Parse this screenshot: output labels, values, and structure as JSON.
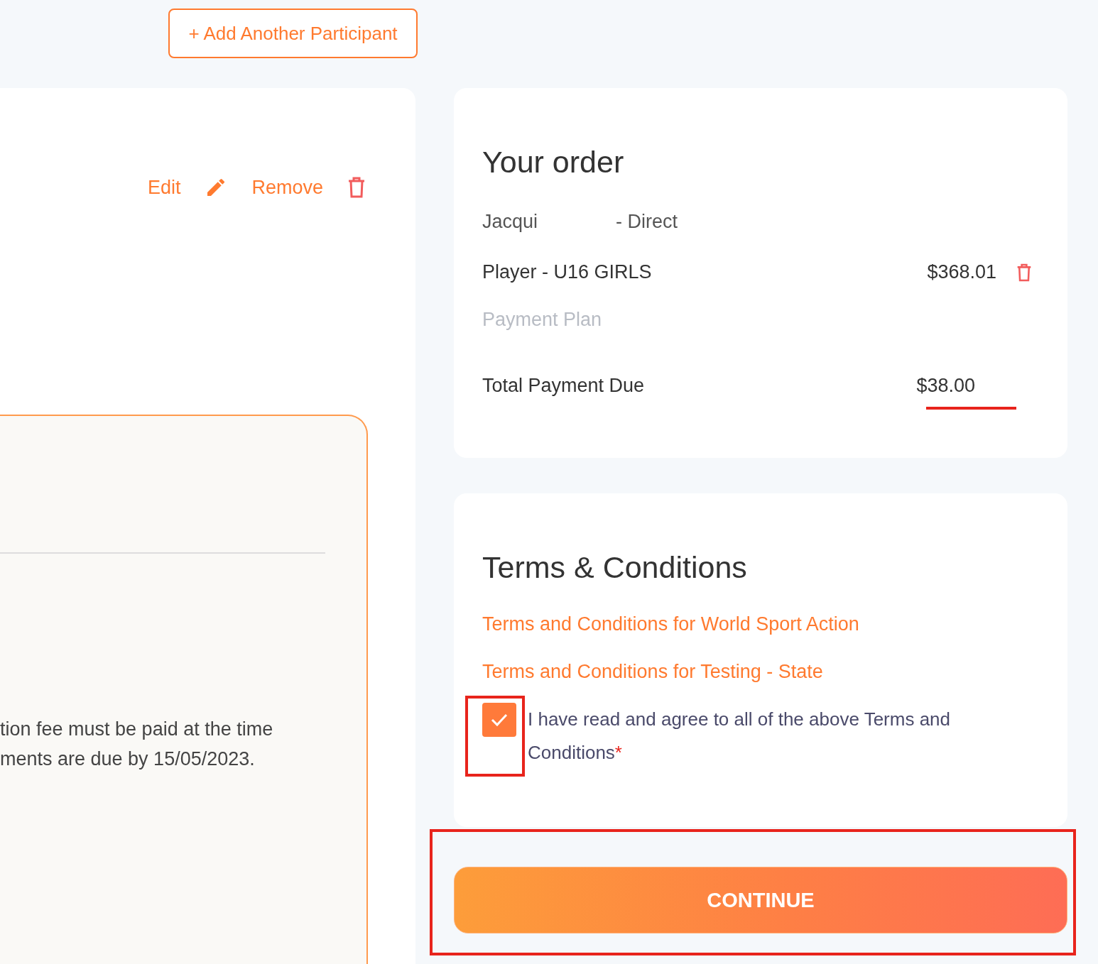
{
  "add_participant_button": "+ Add Another Participant",
  "participant_card": {
    "actions": [
      {
        "kind": "edit",
        "label": "Edit"
      },
      {
        "kind": "remove",
        "label": "Remove"
      }
    ],
    "info_lines": [
      "tion fee must be paid at the time",
      "ments are due by 15/05/2023."
    ]
  },
  "order": {
    "title": "Your order",
    "participant_name": "Jacqui",
    "participant_type": "- Direct",
    "item_name": "Player - U16 GIRLS",
    "item_price": "$368.01",
    "payment_option": "Payment Plan",
    "total_label": "Total Payment Due",
    "total_value": "$38.00"
  },
  "terms": {
    "title": "Terms & Conditions",
    "links": [
      "Terms and Conditions for World Sport Action",
      "Terms and Conditions for Testing - State"
    ],
    "agree_text": "I have read and agree to all of the above Terms and Conditions",
    "required_mark": "*",
    "checked": true
  },
  "continue_button": "CONTINUE"
}
